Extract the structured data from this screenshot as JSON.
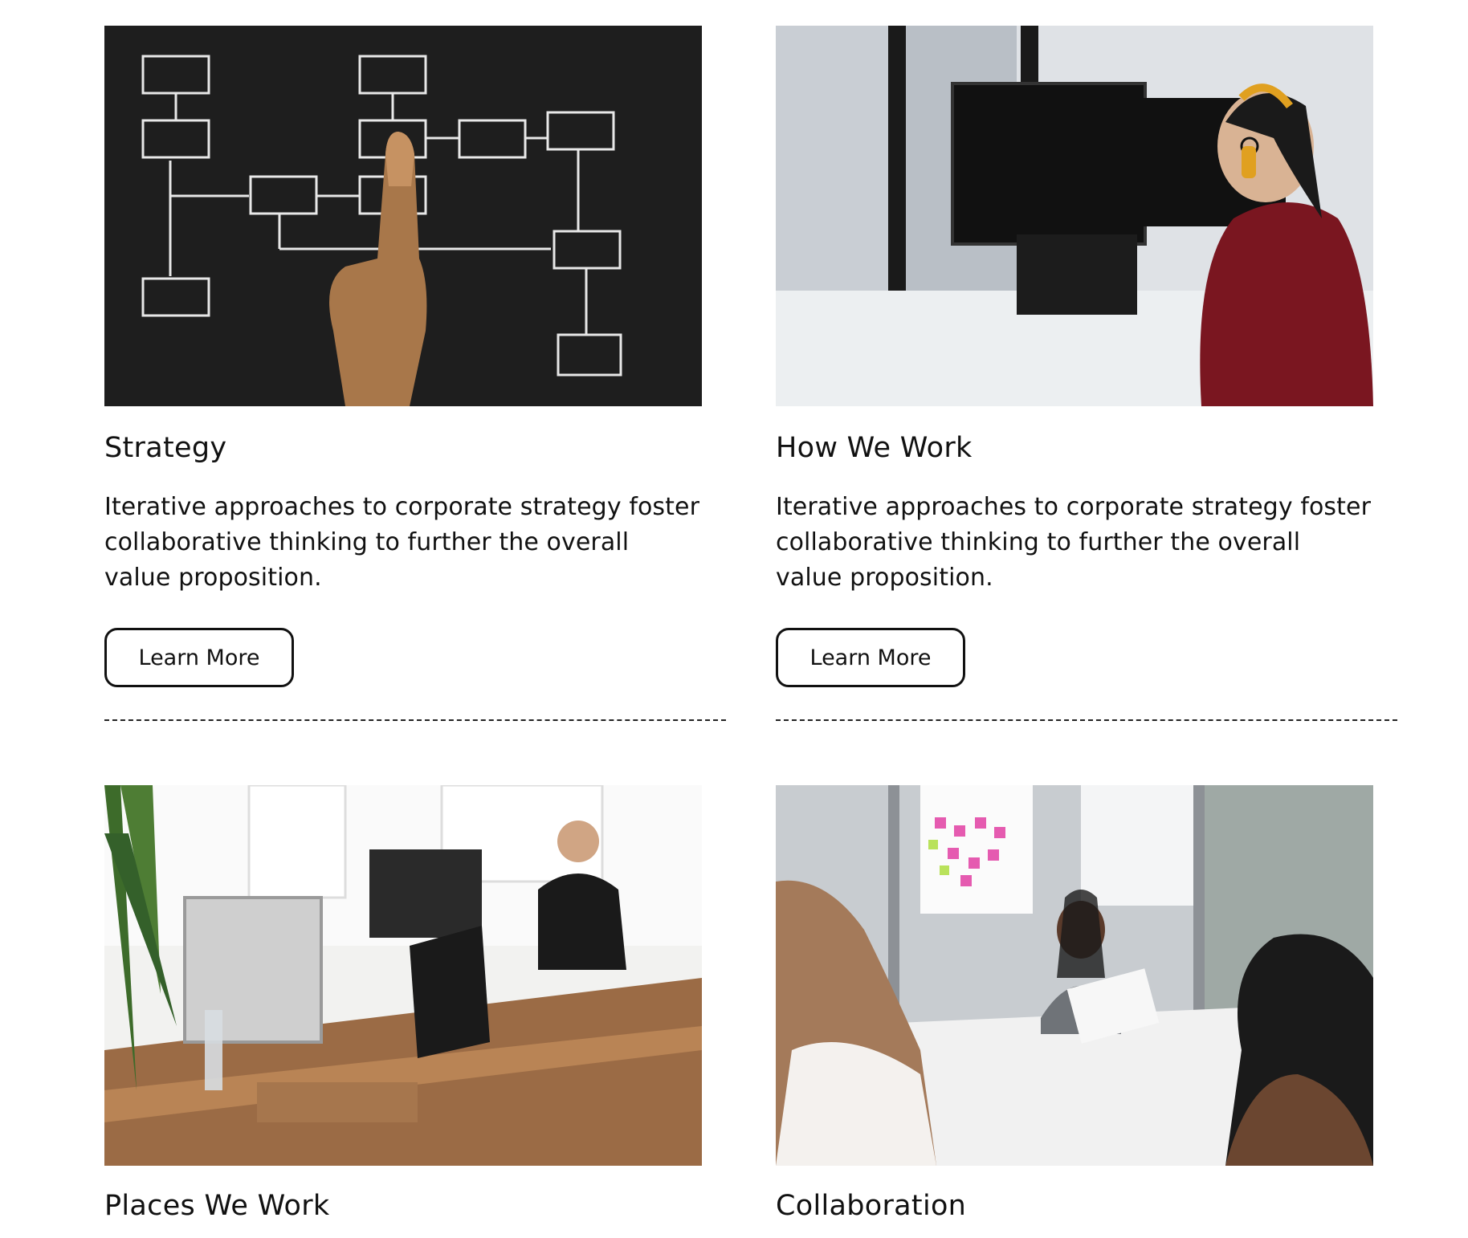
{
  "cards": [
    {
      "title": "Strategy",
      "description": "Iterative approaches to corporate strategy foster collaborative thinking to further the overall value proposition.",
      "button_label": "Learn More",
      "image": "flowchart-chalkboard-photo"
    },
    {
      "title": "How We Work",
      "description": "Iterative approaches to corporate strategy foster collaborative thinking to further the overall value proposition.",
      "button_label": "Learn More",
      "image": "developer-at-standing-desk-photo"
    },
    {
      "title": "Places We Work",
      "image": "open-office-workspace-photo"
    },
    {
      "title": "Collaboration",
      "image": "team-meeting-photo"
    }
  ],
  "colors": {
    "text": "#111111",
    "button_border": "#111111",
    "divider": "#222222",
    "background": "#ffffff"
  }
}
